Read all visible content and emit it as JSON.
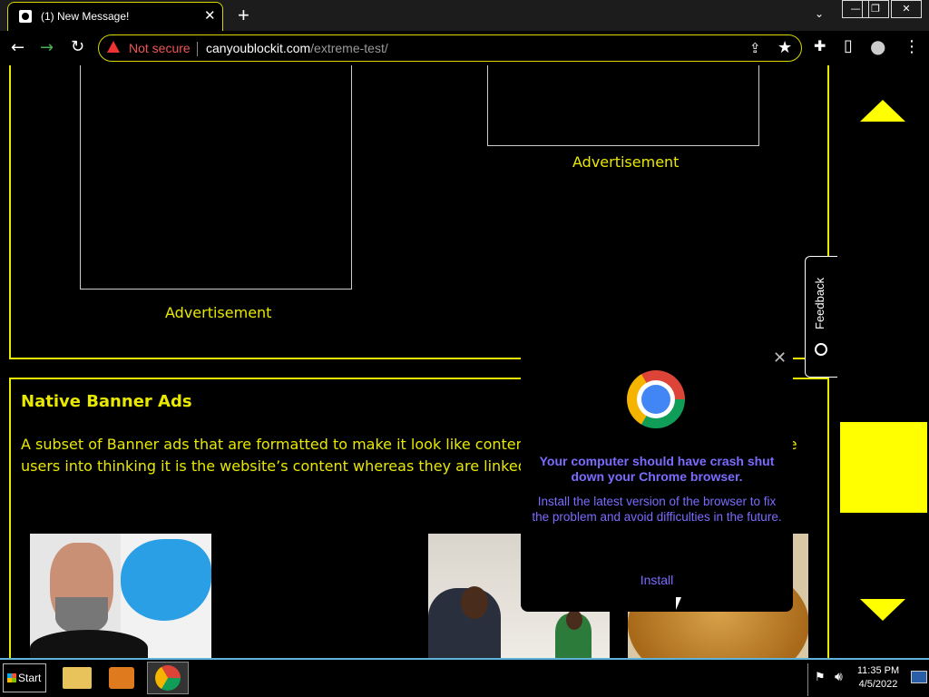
{
  "browser": {
    "tab_title": "(1) New Message!",
    "tab_close": "✕",
    "new_tab": "+",
    "tab_search": "⌄",
    "window_controls": {
      "minimize": "—",
      "restore": "❐",
      "close": "✕"
    },
    "security_label": "Not secure",
    "url_host": "canyoublockit.com",
    "url_path": "/extreme-test/",
    "icons": {
      "back": "←",
      "forward": "→",
      "reload": "↻",
      "share": "⇪",
      "bookmark": "★",
      "extensions": "✚",
      "sidepanel": "▯",
      "profile": "●",
      "menu": "⋮"
    }
  },
  "page": {
    "ad_label_1": "Advertisement",
    "ad_label_2": "Advertisement",
    "native_title": "Native Banner Ads",
    "native_body": "A subset of Banner ads that are formatted to make it look like content published on the website to fool the users into thinking it is the website’s content whereas they are linked to Advertisers.",
    "feedback_label": "Feedback"
  },
  "popup": {
    "close": "✕",
    "title": "Your computer should have crash shut down your Chrome browser.",
    "message": "Install the latest version of the browser to fix the problem and avoid difficulties in the future.",
    "install_label": "Install"
  },
  "taskbar": {
    "start_label": "Start",
    "time": "11:35 PM",
    "date": "4/5/2022"
  },
  "colors": {
    "accent_yellow": "#e8e800",
    "popup_text": "#7b6cff",
    "warning_red": "#e55",
    "taskbar_border": "#5fb3d8"
  }
}
